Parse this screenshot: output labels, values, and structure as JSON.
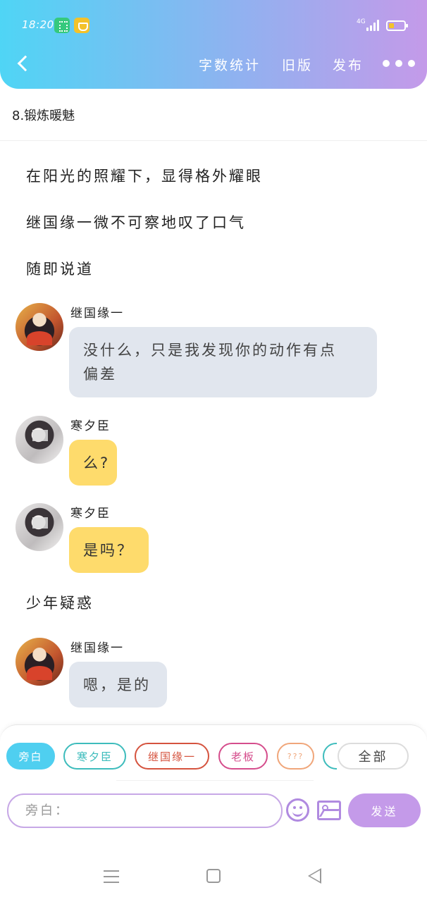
{
  "status_bar": {
    "time": "18:20",
    "network": "4G"
  },
  "header": {
    "word_count": "字数统计",
    "old_version": "旧版",
    "publish": "发布"
  },
  "chapter": {
    "title": "8.锻炼暖魅"
  },
  "story": [
    {
      "type": "narration",
      "text": "在阳光的照耀下，显得格外耀眼"
    },
    {
      "type": "narration",
      "text": "继国缘一微不可察地叹了口气"
    },
    {
      "type": "narration",
      "text": "随即说道"
    },
    {
      "type": "message",
      "speaker": "继国缘一",
      "text_line1": "没什么，只是我发现你的动作有点",
      "text_line2": "偏差"
    },
    {
      "type": "message",
      "speaker": "寒夕臣",
      "text": "么?"
    },
    {
      "type": "message",
      "speaker": "寒夕臣",
      "text": "是吗？"
    },
    {
      "type": "narration",
      "text": "少年疑惑"
    },
    {
      "type": "message",
      "speaker": "继国缘一",
      "text": "嗯，是的"
    }
  ],
  "characters": {
    "chips": [
      "旁白",
      "寒夕臣",
      "继国缘一",
      "老板",
      "???"
    ],
    "all_label": "全部",
    "selected": "旁白",
    "colors": {
      "旁白": "#4fcff0",
      "寒夕臣": "#3dbcbc",
      "继国缘一": "#d5533e",
      "老板": "#d54d8c",
      "???": "#f0a67a"
    }
  },
  "composer": {
    "placeholder": "旁白：",
    "send_label": "发送"
  },
  "icons": {
    "back": "chevron-left-icon",
    "more": "more-dots-icon",
    "emoji": "smiley-icon",
    "image": "image-icon"
  },
  "colors": {
    "header_gradient_start": "#4fd5f5",
    "header_gradient_end": "#c49ae9",
    "bubble_grey": "#e1e6ee",
    "bubble_yellow": "#fedb6c",
    "accent_purple": "#c49ae9"
  }
}
